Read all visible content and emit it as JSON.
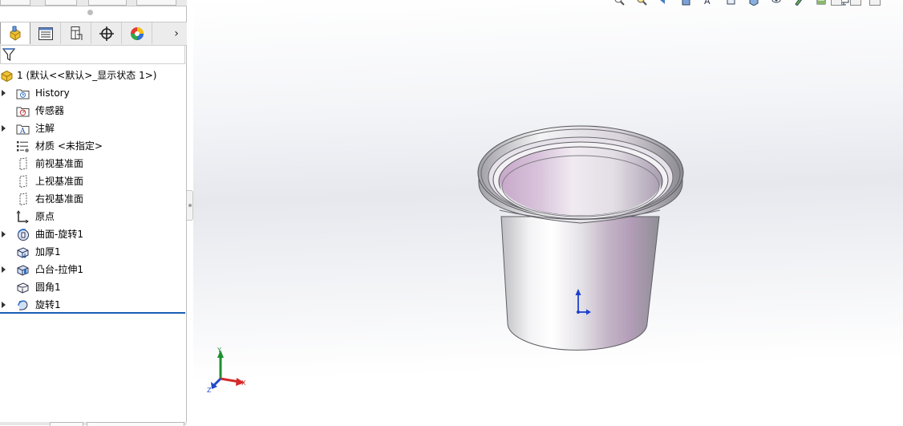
{
  "feature_manager": {
    "root": {
      "label": "1  (默认<<默认>_显示状态 1>)",
      "icon": "part-icon"
    },
    "items": [
      {
        "label": "History",
        "icon": "history-folder-icon",
        "expandable": true
      },
      {
        "label": "传感器",
        "icon": "sensor-icon",
        "expandable": false
      },
      {
        "label": "注解",
        "icon": "annotations-icon",
        "expandable": true
      },
      {
        "label": "材质 <未指定>",
        "icon": "material-icon",
        "expandable": false
      },
      {
        "label": "前视基准面",
        "icon": "plane-icon",
        "expandable": false
      },
      {
        "label": "上视基准面",
        "icon": "plane-icon",
        "expandable": false
      },
      {
        "label": "右视基准面",
        "icon": "plane-icon",
        "expandable": false
      },
      {
        "label": "原点",
        "icon": "origin-icon",
        "expandable": false
      },
      {
        "label": "曲面-旋转1",
        "icon": "surface-revolve-icon",
        "expandable": true
      },
      {
        "label": "加厚1",
        "icon": "thicken-icon",
        "expandable": false
      },
      {
        "label": "凸台-拉伸1",
        "icon": "boss-extrude-icon",
        "expandable": true
      },
      {
        "label": "圆角1",
        "icon": "fillet-icon",
        "expandable": false
      },
      {
        "label": "旋转1",
        "icon": "revolve-icon",
        "expandable": true
      }
    ],
    "tabs": [
      {
        "name": "featuremanager-tab",
        "icon": "featuremanager-icon",
        "active": true
      },
      {
        "name": "propertymanager-tab",
        "icon": "propertymanager-icon",
        "active": false
      },
      {
        "name": "configurationmanager-tab",
        "icon": "configurationmanager-icon",
        "active": false
      },
      {
        "name": "dimxpert-tab",
        "icon": "dimxpert-icon",
        "active": false
      },
      {
        "name": "display-manager-tab",
        "icon": "display-manager-icon",
        "active": false
      }
    ],
    "more_tabs_glyph": "›"
  },
  "viewport": {
    "triad": {
      "x_label": "X",
      "y_label": "Y",
      "z_label": "Z"
    },
    "colors": {
      "x_axis": "#d42a2a",
      "y_axis": "#1f8f2f",
      "z_axis": "#2148c9",
      "model_accent": "#c6a7c8"
    }
  }
}
